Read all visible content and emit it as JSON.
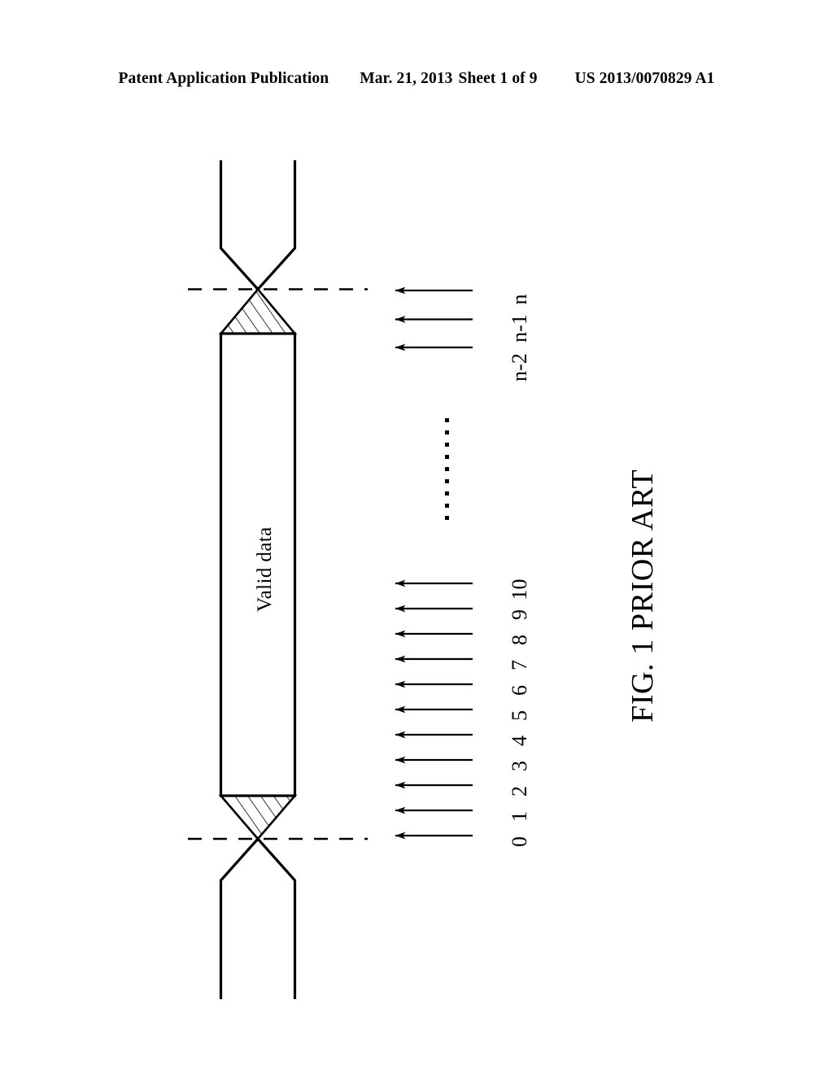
{
  "header": {
    "publication": "Patent Application Publication",
    "date": "Mar. 21, 2013",
    "sheet": "Sheet 1 of 9",
    "docnum": "US 2013/0070829 A1"
  },
  "figure": {
    "caption": "FIG. 1 PRIOR ART",
    "valid_data_label": "Valid data",
    "ellipsis_dots": 9,
    "stroke_color": "#000000",
    "fill_color": "#ffffff",
    "low_group": {
      "arrow_count": 11,
      "labels": [
        "0",
        "1",
        "2",
        "3",
        "4",
        "5",
        "6",
        "7",
        "8",
        "9",
        "10"
      ]
    },
    "high_group": {
      "arrow_count": 3,
      "labels": [
        "n-2",
        "n-1",
        "n"
      ]
    }
  },
  "chart_data": {
    "type": "table",
    "title": "FIG. 1 PRIOR ART",
    "description": "Timing / eye diagram of a data bus window showing the valid data interval bounded by two hatched transition regions, with sampling instants marked by arrows.",
    "regions": [
      {
        "name": "transition-hatched-top",
        "label": ""
      },
      {
        "name": "valid-data-window",
        "label": "Valid data"
      },
      {
        "name": "transition-hatched-bottom",
        "label": ""
      }
    ],
    "sampling_points": [
      "0",
      "1",
      "2",
      "3",
      "4",
      "5",
      "6",
      "7",
      "8",
      "9",
      "10",
      "n-2",
      "n-1",
      "n"
    ],
    "gap_marker": "......."
  }
}
